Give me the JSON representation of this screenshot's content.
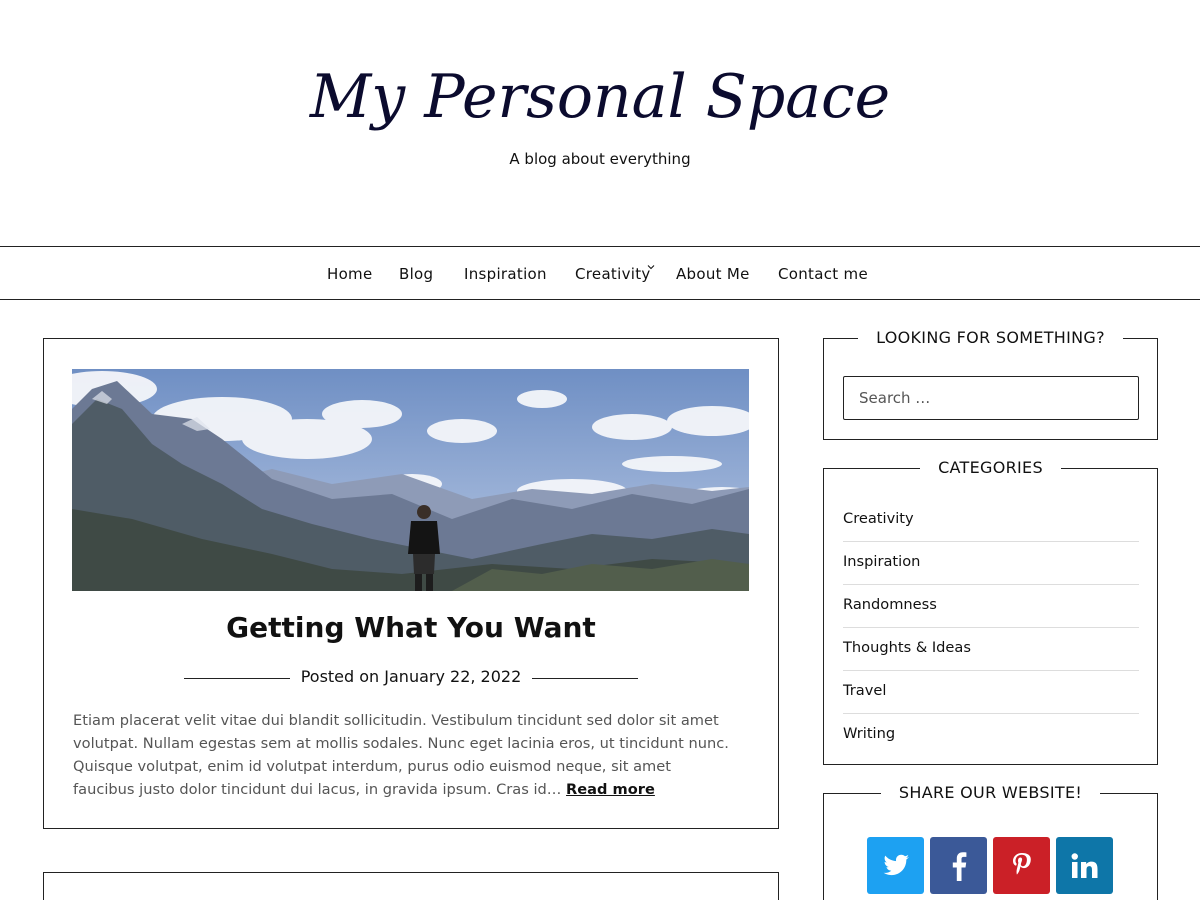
{
  "header": {
    "title": "My Personal Space",
    "tagline": "A blog about everything"
  },
  "nav": {
    "items": [
      "Home",
      "Blog",
      "Inspiration",
      "Creativity",
      "About Me",
      "Contact me"
    ]
  },
  "post": {
    "title": "Getting What You Want",
    "meta": "Posted on January 22, 2022",
    "excerpt": "Etiam placerat velit vitae dui blandit sollicitudin. Vestibulum tincidunt sed dolor sit amet volutpat. Nullam egestas sem at mollis sodales. Nunc eget lacinia eros, ut tincidunt nunc. Quisque volutpat, enim id volutpat interdum, purus odio euismod neque, sit amet faucibus justo dolor tincidunt dui lacus, in gravida ipsum. Cras id…",
    "read_more": "Read more"
  },
  "sidebar": {
    "search": {
      "title": "LOOKING FOR SOMETHING?",
      "placeholder": "Search …"
    },
    "categories": {
      "title": "CATEGORIES",
      "items": [
        "Creativity",
        "Inspiration",
        "Randomness",
        "Thoughts & Ideas",
        "Travel",
        "Writing"
      ]
    },
    "share": {
      "title": "SHARE OUR WEBSITE!",
      "buttons": [
        {
          "name": "twitter",
          "color": "#1da1f2"
        },
        {
          "name": "facebook",
          "color": "#3b5998"
        },
        {
          "name": "pinterest",
          "color": "#cb2027"
        },
        {
          "name": "linkedin",
          "color": "#0e76a8"
        }
      ]
    }
  }
}
